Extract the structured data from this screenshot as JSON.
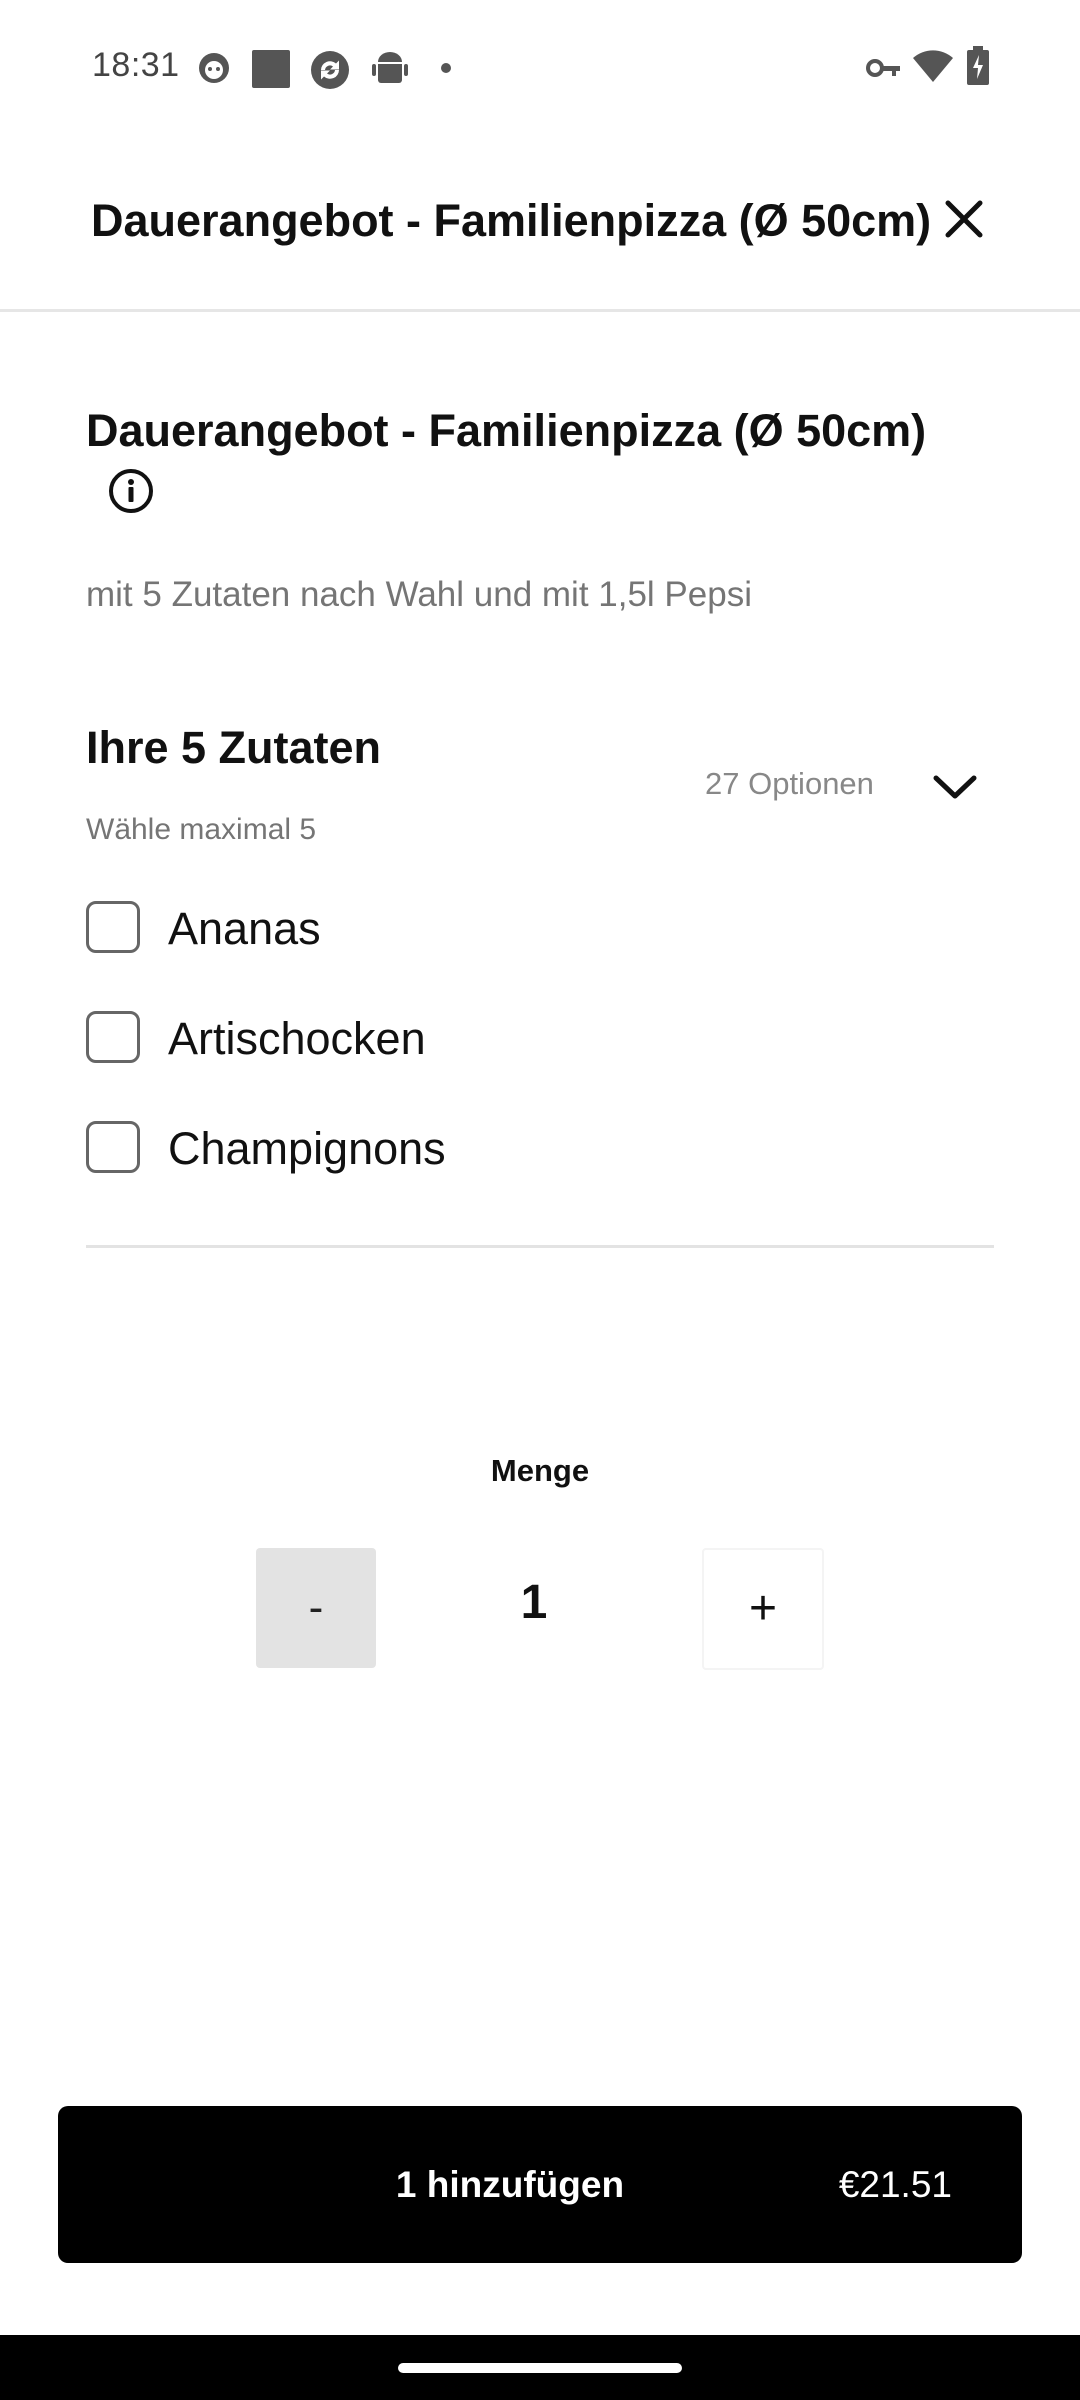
{
  "status_bar": {
    "time": "18:31"
  },
  "header": {
    "title": "Dauerangebot - Familienpizza (Ø 50cm)"
  },
  "product": {
    "title": "Dauerangebot - Familienpizza (Ø 50cm)",
    "description": "mit 5 Zutaten nach Wahl und mit 1,5l Pepsi"
  },
  "ingredients": {
    "title": "Ihre 5 Zutaten",
    "subtitle": "Wähle maximal 5",
    "options_count": "27 Optionen",
    "options": [
      {
        "label": "Ananas",
        "checked": false
      },
      {
        "label": "Artischocken",
        "checked": false
      },
      {
        "label": "Champignons",
        "checked": false
      }
    ]
  },
  "quantity": {
    "label": "Menge",
    "minus": "-",
    "value": "1",
    "plus": "+"
  },
  "add_button": {
    "label": "1 hinzufügen",
    "price": "€21.51"
  },
  "colors": {
    "primary_button": "#000000",
    "muted_text": "#757575",
    "stepper_disabled": "#e3e3e3"
  },
  "icons": {
    "close": "close-icon",
    "info": "info-icon",
    "expand": "chevron-down-icon"
  }
}
